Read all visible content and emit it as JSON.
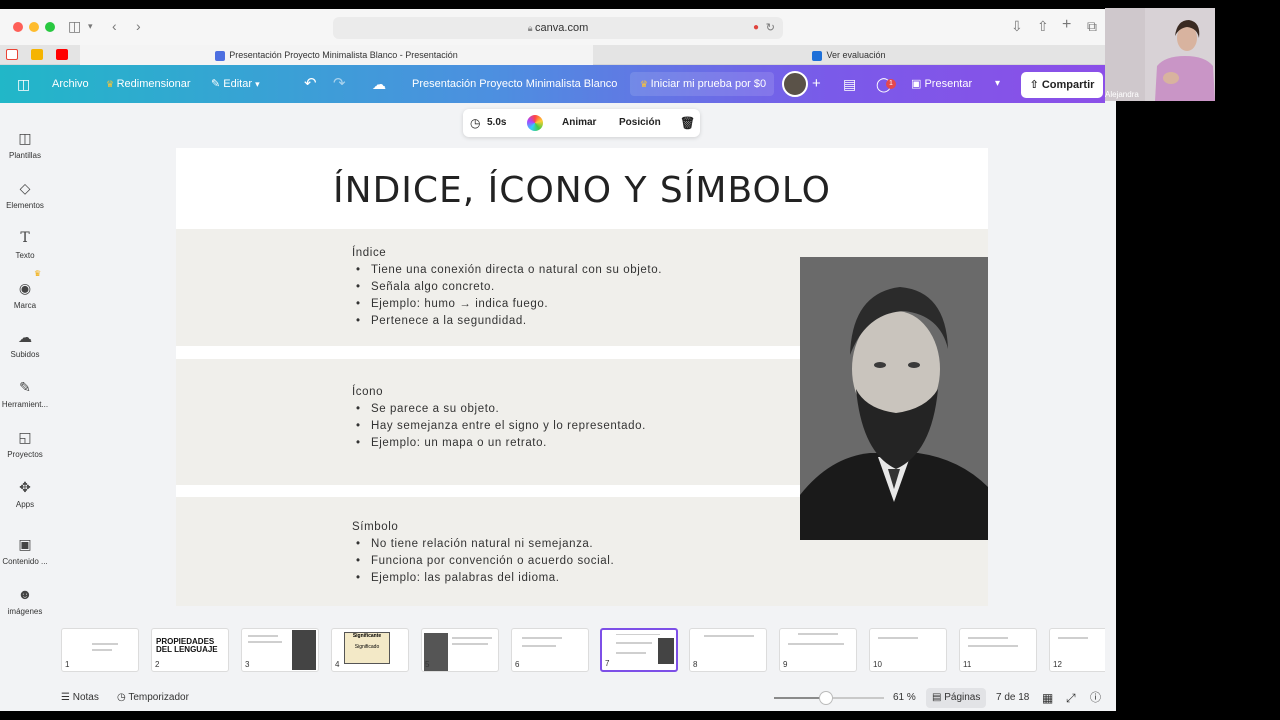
{
  "browser": {
    "url": "canva.com",
    "tabs": [
      {
        "label": "Presentación Proyecto Minimalista Blanco - Presentación"
      },
      {
        "label": "Ver evaluación"
      }
    ]
  },
  "toolbar": {
    "file": "Archivo",
    "resize": "Redimensionar",
    "edit": "Editar",
    "doc_title": "Presentación Proyecto Minimalista Blanco",
    "trial": "Iniciar mi prueba por $0",
    "comment_badge": "1",
    "present": "Presentar",
    "share": "Compartir"
  },
  "sidebar": {
    "items": [
      {
        "label": "Plantillas",
        "icon": "templates-icon"
      },
      {
        "label": "Elementos",
        "icon": "elements-icon"
      },
      {
        "label": "Texto",
        "icon": "text-icon"
      },
      {
        "label": "Marca",
        "icon": "brand-icon"
      },
      {
        "label": "Subidos",
        "icon": "uploads-icon"
      },
      {
        "label": "Herramient...",
        "icon": "tools-icon"
      },
      {
        "label": "Proyectos",
        "icon": "projects-icon"
      },
      {
        "label": "Apps",
        "icon": "apps-icon"
      },
      {
        "label": "Contenido ...",
        "icon": "content-icon"
      },
      {
        "label": "imágenes",
        "icon": "images-icon"
      }
    ]
  },
  "element_toolbar": {
    "duration": "5.0s",
    "animate": "Animar",
    "position": "Posición"
  },
  "slide": {
    "title": "ÍNDICE, ÍCONO Y SÍMBOLO",
    "sections": [
      {
        "title": "Índice",
        "bullets": [
          "Tiene una conexión directa o natural con su objeto.",
          "Señala algo concreto.",
          "Ejemplo: humo → indica fuego.",
          "Pertenece a la segundidad."
        ]
      },
      {
        "title": "Ícono",
        "bullets": [
          "Se parece a su objeto.",
          "Hay semejanza entre el signo y lo representado.",
          "Ejemplo: un mapa o un retrato."
        ]
      },
      {
        "title": "Símbolo",
        "bullets": [
          "No tiene relación natural ni semejanza.",
          "Funciona por convención o acuerdo social.",
          "Ejemplo: las palabras del idioma."
        ]
      }
    ]
  },
  "thumbnails": {
    "pages": [
      "1",
      "2",
      "3",
      "4",
      "5",
      "6",
      "7",
      "8",
      "9",
      "10",
      "11",
      "12"
    ],
    "active_page": "7",
    "page2_title": "PROPIEDADES DEL LENGUAJE",
    "page4_labels": [
      "Significante",
      "Significado"
    ]
  },
  "bottom_bar": {
    "notes": "Notas",
    "timer": "Temporizador",
    "zoom": "61 %",
    "zoom_level": 0.47,
    "pages": "Páginas",
    "page_count": "7 de 18"
  },
  "participant": {
    "name": "Alejandra"
  },
  "colors": {
    "toolbar_start": "#21b7c8",
    "toolbar_end": "#8b4fe8",
    "active_thumb": "#7d4fe7",
    "band": "#f0efeb"
  }
}
